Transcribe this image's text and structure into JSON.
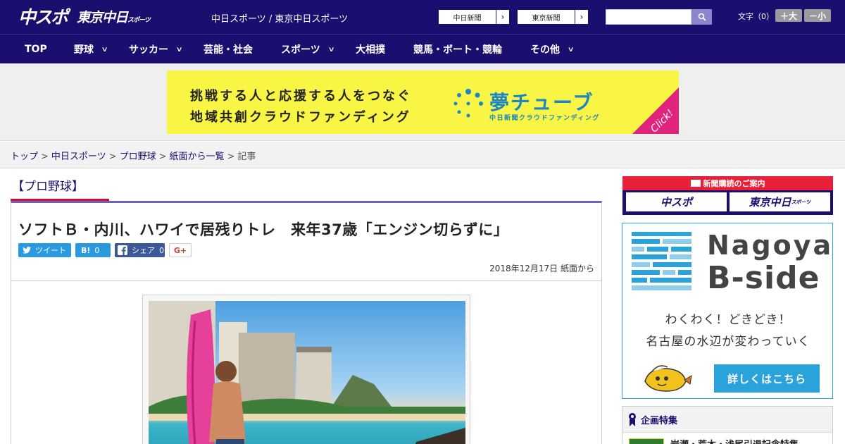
{
  "header": {
    "logo_main": "中スポ",
    "logo_tokyo": "東京中日",
    "logo_tokyo_small": "スポーツ",
    "site_links": "中日スポーツ / 東京中日スポーツ",
    "paper_links": [
      {
        "label": "中日新聞"
      },
      {
        "label": "東京新聞"
      }
    ],
    "search": {
      "placeholder": ""
    },
    "font_size_label": "文字（0）",
    "font_larger": "＋大",
    "font_smaller": "－小"
  },
  "nav": {
    "items": [
      {
        "label": "TOP",
        "has_menu": false
      },
      {
        "label": "野球",
        "has_menu": true
      },
      {
        "label": "サッカー",
        "has_menu": true
      },
      {
        "label": "芸能・社会",
        "has_menu": false
      },
      {
        "label": "スポーツ",
        "has_menu": true
      },
      {
        "label": "大相撲",
        "has_menu": false
      },
      {
        "label": "競馬・ボート・競輪",
        "has_menu": false
      },
      {
        "label": "その他",
        "has_menu": true
      }
    ],
    "chevron": "∨"
  },
  "ad_banner": {
    "line1": "挑戦する人と応援する人をつなぐ",
    "line2": "地域共創クラウドファンディング",
    "brand": "夢チューブ",
    "brand_sub": "中日新聞クラウドファンディング",
    "click": "Click!"
  },
  "breadcrumb": {
    "items": [
      "トップ",
      "中日スポーツ",
      "プロ野球",
      "紙面から一覧"
    ],
    "current": "記事",
    "separator": ">"
  },
  "category": {
    "label": "【プロ野球】"
  },
  "article": {
    "headline": "ソフトＢ・内川、ハワイで居残りトレ　来年37歳「エンジン切らずに」",
    "share": {
      "tweet_label": "ツイート",
      "hatena_label": "B!",
      "hatena_count": "0",
      "facebook_label": "シェア",
      "facebook_count": "0",
      "gplus_label": "G+"
    },
    "date": "2018年12月17日",
    "source": "紙面から"
  },
  "sidebar": {
    "subscribe": {
      "title": "新聞購読のご案内",
      "logo1": "中スポ",
      "logo2": "東京中日",
      "logo2_small": "スポーツ"
    },
    "bside": {
      "title1": "Nagoya",
      "title2": "B-side",
      "copy1": "わくわく！どきどき！",
      "copy2": "名古屋の水辺が変わっていく",
      "cta": "詳しくはこちら"
    },
    "feature": {
      "heading": "企画特集",
      "item": "岩瀬・荒木・浅尾引退記念特集"
    }
  },
  "colors": {
    "brand_navy": "#1a0e6e",
    "accent_red": "#d0102a",
    "banner_yellow": "#f8f545",
    "bside_blue": "#2aa3dc"
  }
}
